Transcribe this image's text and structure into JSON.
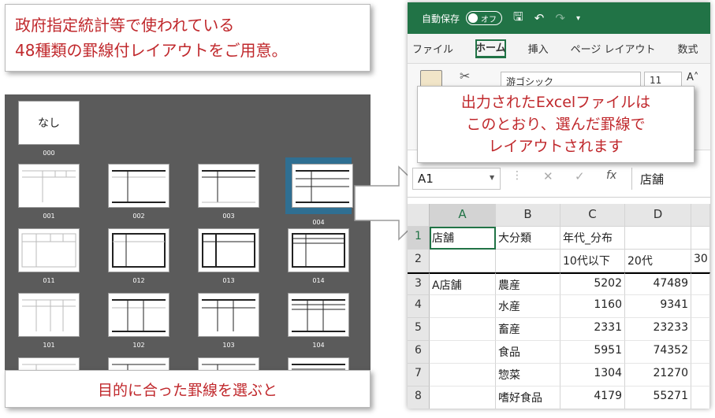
{
  "callout_top": {
    "line1": "政府指定統計等で使われている",
    "line2": "48種類の罫線付レイアウトをご用意。"
  },
  "panel": {
    "layouts": [
      {
        "code": "000",
        "label": "なし"
      },
      {
        "code": "001"
      },
      {
        "code": "002"
      },
      {
        "code": "003"
      },
      {
        "code": "004"
      },
      {
        "code": "011"
      },
      {
        "code": "012"
      },
      {
        "code": "013"
      },
      {
        "code": "014"
      },
      {
        "code": "101"
      },
      {
        "code": "102"
      },
      {
        "code": "103"
      },
      {
        "code": "104"
      }
    ],
    "selected": "004",
    "caption": "目的に合った罫線を選ぶと"
  },
  "excel": {
    "autosave_label": "自動保存",
    "autosave_state": "オフ",
    "tabs": [
      "ファイル",
      "ホーム",
      "挿入",
      "ページ レイアウト",
      "数式"
    ],
    "active_tab": "ホーム",
    "font_name": "游ゴシック",
    "font_size": "11",
    "name_box": "A1",
    "formula_content": "店舗",
    "callout": {
      "line1": "出力されたExcelファイルは",
      "line2": "このとおり、選んだ罫線で",
      "line3": "レイアウトされます"
    },
    "columns": [
      "A",
      "B",
      "C",
      "D"
    ],
    "rows": [
      {
        "n": "1",
        "a": "店舗",
        "b": "大分類",
        "c": "年代_分布",
        "d": ""
      },
      {
        "n": "2",
        "a": "",
        "b": "",
        "c": "10代以下",
        "d": "20代",
        "e": "30"
      },
      {
        "n": "3",
        "a": "A店舗",
        "b": "農産",
        "c": "5202",
        "d": "47489"
      },
      {
        "n": "4",
        "a": "",
        "b": "水産",
        "c": "1160",
        "d": "9341"
      },
      {
        "n": "5",
        "a": "",
        "b": "畜産",
        "c": "2331",
        "d": "23233"
      },
      {
        "n": "6",
        "a": "",
        "b": "食品",
        "c": "5951",
        "d": "74352"
      },
      {
        "n": "7",
        "a": "",
        "b": "惣菜",
        "c": "1304",
        "d": "21270"
      },
      {
        "n": "8",
        "a": "",
        "b": "嗜好食品",
        "c": "4179",
        "d": "55271"
      }
    ]
  }
}
